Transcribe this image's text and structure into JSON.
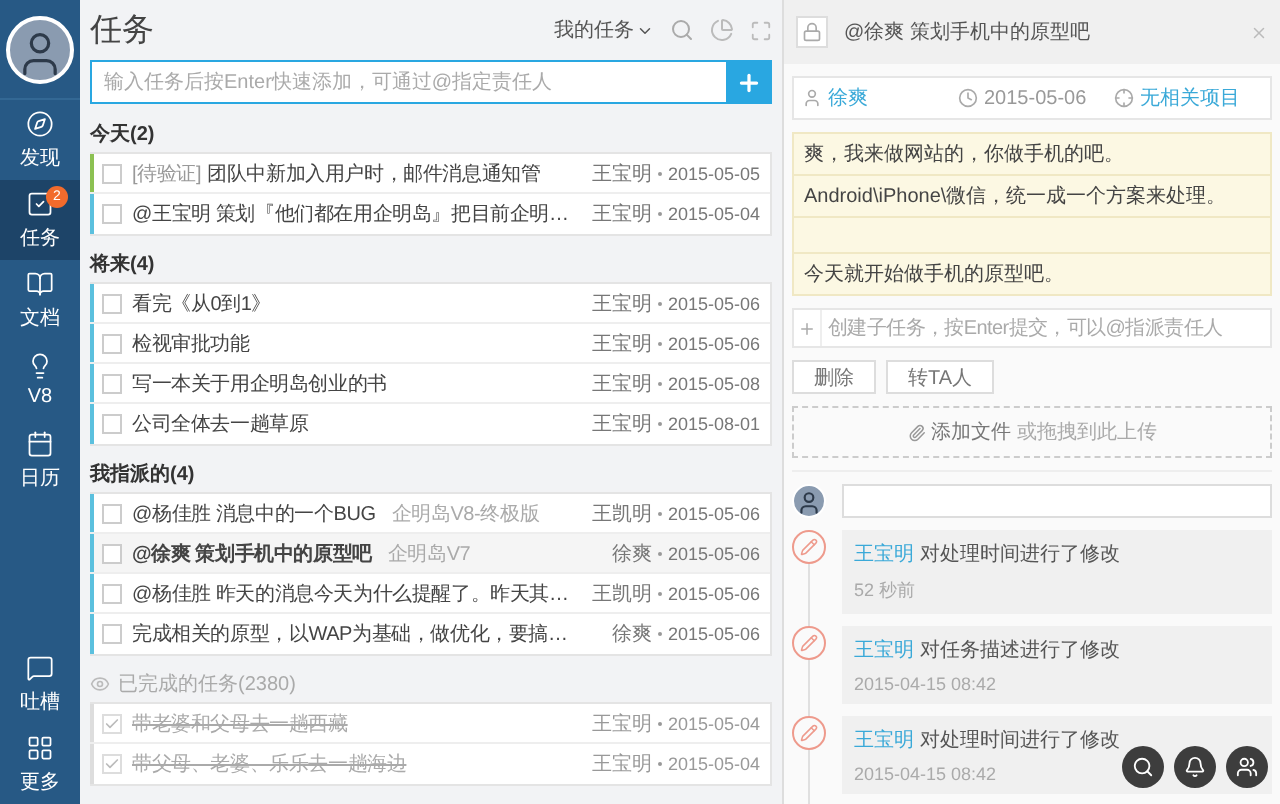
{
  "sidebar": {
    "items": [
      {
        "label": "发现",
        "selected": false
      },
      {
        "label": "任务",
        "selected": true,
        "badge": "2"
      },
      {
        "label": "文档",
        "selected": false
      },
      {
        "label": "V8",
        "selected": false
      },
      {
        "label": "日历",
        "selected": false
      }
    ],
    "bottom_items": [
      {
        "label": "吐槽"
      },
      {
        "label": "更多"
      }
    ]
  },
  "task_list": {
    "title": "任务",
    "filter": "我的任务",
    "input_placeholder": "输入任务后按Enter快速添加，可通过@指定责任人",
    "sections": [
      {
        "kind": "open",
        "title": "今天(2)",
        "tasks": [
          {
            "status": "[待验证]",
            "title": "团队中新加入用户时，邮件消息通知管",
            "assignee": "王宝明",
            "date": "2015-05-05",
            "checked": false,
            "selected": false,
            "color": "#8cc152"
          },
          {
            "title": "@王宝明 策划『他们都在用企明岛』把目前企明…",
            "assignee": "王宝明",
            "date": "2015-05-04",
            "checked": false,
            "selected": false,
            "color": "#5bc0de"
          }
        ]
      },
      {
        "kind": "open",
        "title": "将来(4)",
        "tasks": [
          {
            "title": "看完《从0到1》",
            "assignee": "王宝明",
            "date": "2015-05-06",
            "checked": false,
            "selected": false,
            "color": "#5bc0de"
          },
          {
            "title": "检视审批功能",
            "assignee": "王宝明",
            "date": "2015-05-06",
            "checked": false,
            "selected": false,
            "color": "#5bc0de"
          },
          {
            "title": "写一本关于用企明岛创业的书",
            "assignee": "王宝明",
            "date": "2015-05-08",
            "checked": false,
            "selected": false,
            "color": "#5bc0de"
          },
          {
            "title": "公司全体去一趟草原",
            "assignee": "王宝明",
            "date": "2015-08-01",
            "checked": false,
            "selected": false,
            "color": "#5bc0de"
          }
        ]
      },
      {
        "kind": "open",
        "title": "我指派的(4)",
        "tasks": [
          {
            "title": "@杨佳胜 消息中的一个BUG",
            "tag": "企明岛V8-终极版",
            "assignee": "王凯明",
            "date": "2015-05-06",
            "checked": false,
            "selected": false,
            "color": "#5bc0de"
          },
          {
            "title": "@徐爽 策划手机中的原型吧",
            "tag": "企明岛V7",
            "assignee": "徐爽",
            "date": "2015-05-06",
            "checked": false,
            "selected": true,
            "color": "#5bc0de"
          },
          {
            "title": "@杨佳胜 昨天的消息今天为什么提醒了。昨天其…",
            "assignee": "王凯明",
            "date": "2015-05-06",
            "checked": false,
            "selected": false,
            "color": "#5bc0de"
          },
          {
            "title": "完成相关的原型，以WAP为基础，做优化，要搞…",
            "assignee": "徐爽",
            "date": "2015-05-06",
            "checked": false,
            "selected": false,
            "color": "#5bc0de"
          }
        ]
      },
      {
        "kind": "done",
        "title": "已完成的任务(2380)",
        "tasks": [
          {
            "title": "带老婆和父母去一趟西藏",
            "assignee": "王宝明",
            "date": "2015-05-04",
            "checked": true,
            "selected": false,
            "color": "#dddddd"
          },
          {
            "title": "带父母、老婆、乐乐去一趟海边",
            "assignee": "王宝明",
            "date": "2015-05-04",
            "checked": true,
            "selected": false,
            "color": "#dddddd"
          }
        ]
      }
    ]
  },
  "detail": {
    "title": "@徐爽 策划手机中的原型吧",
    "assignee": "徐爽",
    "date": "2015-05-06",
    "project": "无相关项目",
    "description": [
      {
        "kind": "text",
        "text": "爽，我来做网站的，你做手机的吧。"
      },
      {
        "kind": "text",
        "text": "Android\\iPhone\\微信，统一成一个方案来处理。"
      },
      {
        "kind": "blank"
      },
      {
        "kind": "text",
        "text": "今天就开始做手机的原型吧。"
      }
    ],
    "subtask_placeholder": "创建子任务，按Enter提交，可以@指派责任人",
    "buttons": [
      "删除",
      "转TA人"
    ],
    "attach": {
      "label": "添加文件",
      "hint": "或拖拽到此上传"
    },
    "activities": [
      {
        "user": "王宝明",
        "action": "对处理时间进行了修改",
        "time": "52 秒前"
      },
      {
        "user": "王宝明",
        "action": "对任务描述进行了修改",
        "time": "2015-04-15 08:42"
      },
      {
        "user": "王宝明",
        "action": "对处理时间进行了修改",
        "time": "2015-04-15 08:42"
      }
    ]
  }
}
